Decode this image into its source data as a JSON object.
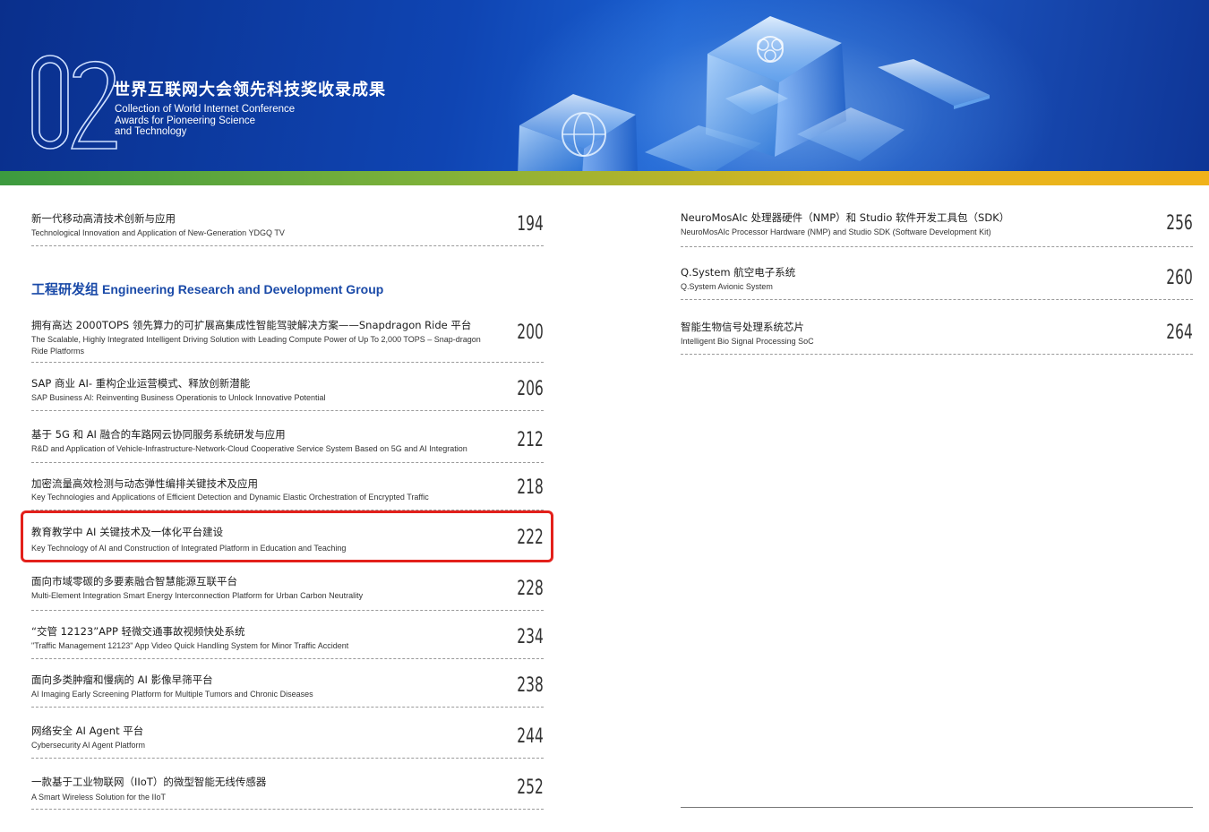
{
  "banner": {
    "number": "02",
    "title_cn": "世界互联网大会领先科技奖收录成果",
    "title_en_lines": [
      "Collection of World Internet Conference",
      "Awards for Pioneering Science",
      "and Technology"
    ]
  },
  "section": {
    "cn": "工程研发组",
    "en": "Engineering Research and Development Group"
  },
  "left_entries": [
    {
      "cn": "新一代移动高清技术创新与应用",
      "en": "Technological Innovation and Application of New-Generation YDGQ TV",
      "page": "194"
    },
    {
      "cn": "拥有高达 2000TOPS 领先算力的可扩展高集成性智能驾驶解决方案——Snapdragon Ride 平台",
      "en": "The Scalable, Highly Integrated Intelligent Driving Solution with Leading Compute Power of Up To 2,000 TOPS – Snap-dragon Ride Platforms",
      "page": "200"
    },
    {
      "cn": "SAP 商业 AI- 重构企业运营模式、释放创新潜能",
      "en": "SAP Business AI: Reinventing Business Operationis to Unlock Innovative Potential",
      "page": "206"
    },
    {
      "cn": "基于 5G 和 AI 融合的车路网云协同服务系统研发与应用",
      "en": "R&D and Application of Vehicle-Infrastructure-Network-Cloud Cooperative Service System Based on 5G and AI Integration",
      "page": "212"
    },
    {
      "cn": "加密流量高效检测与动态弹性编排关键技术及应用",
      "en": "Key Technologies and Applications of Efficient Detection and Dynamic Elastic Orchestration of Encrypted Traffic",
      "page": "218"
    },
    {
      "cn": "教育教学中 AI 关键技术及一体化平台建设",
      "en": "Key Technology of AI and Construction of Integrated Platform in Education and Teaching",
      "page": "222"
    },
    {
      "cn": "面向市域零碳的多要素融合智慧能源互联平台",
      "en": "Multi-Element Integration Smart Energy Interconnection Platform for Urban Carbon Neutrality",
      "page": "228"
    },
    {
      "cn": "“交管 12123”APP 轻微交通事故视频快处系统",
      "en": "\"Traffic Management 12123\" App Video Quick Handling System for Minor Traffic Accident",
      "page": "234"
    },
    {
      "cn": "面向多类肿瘤和慢病的 AI 影像早筛平台",
      "en": "AI Imaging Early Screening Platform for Multiple Tumors and Chronic Diseases",
      "page": "238"
    },
    {
      "cn": "网络安全 AI Agent 平台",
      "en": "Cybersecurity AI Agent Platform",
      "page": "244"
    },
    {
      "cn": "一款基于工业物联网（IIoT）的微型智能无线传感器",
      "en": "A Smart Wireless Solution for the IIoT",
      "page": "252"
    }
  ],
  "right_entries": [
    {
      "cn": "NeuroMosAIc 处理器硬件（NMP）和 Studio 软件开发工具包（SDK）",
      "en": "NeuroMosAIc Processor Hardware (NMP) and Studio SDK (Software Development Kit)",
      "page": "256"
    },
    {
      "cn": "Q.System 航空电子系统",
      "en": "Q.System Avionic System",
      "page": "260"
    },
    {
      "cn": "智能生物信号处理系统芯片",
      "en": "Intelligent Bio Signal Processing SoC",
      "page": "264"
    }
  ],
  "colors": {
    "accent": "#1a4aa8",
    "highlight": "#e3201b",
    "banner_dark": "#0a2f8c"
  }
}
